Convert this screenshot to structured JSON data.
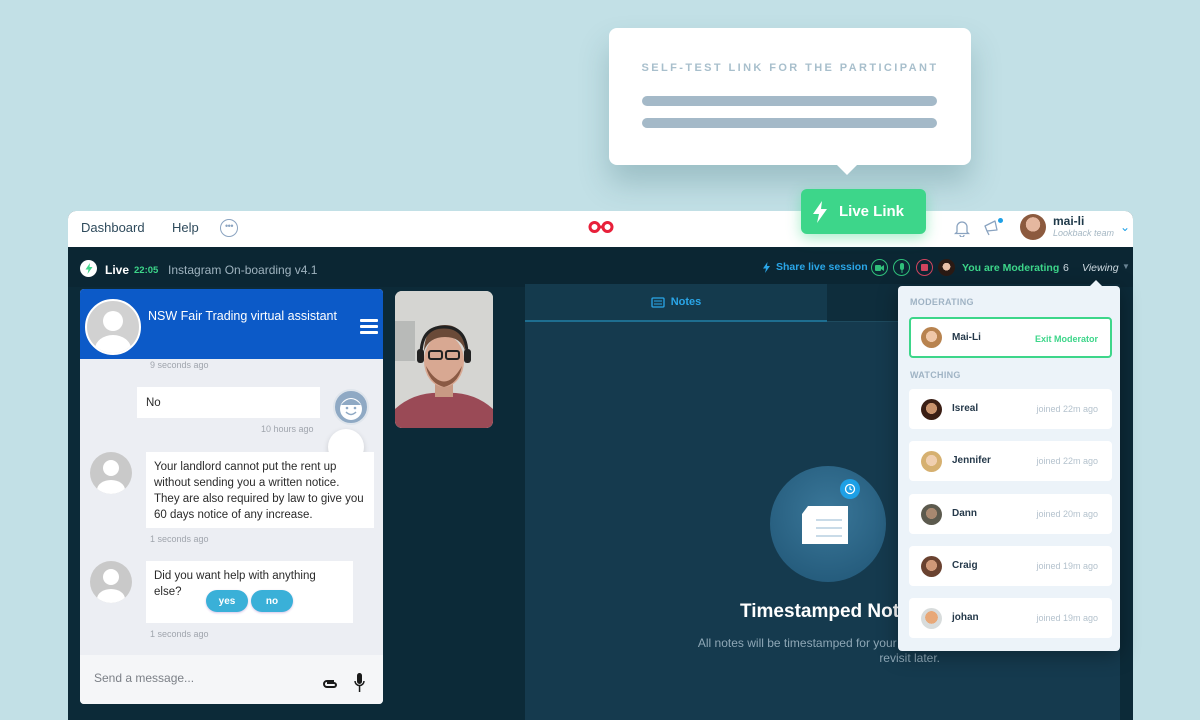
{
  "tooltip": {
    "title": "SELF-TEST LINK FOR THE PARTICIPANT"
  },
  "live_link_button": {
    "label": "Live Link"
  },
  "topbar": {
    "nav": [
      {
        "label": "Dashboard"
      },
      {
        "label": "Help"
      }
    ],
    "more_icon": "ellipsis-icon",
    "logo_icon": "infinity-logo-icon",
    "user": {
      "name": "mai-li",
      "team": "Lookback team"
    }
  },
  "session": {
    "live_label": "Live",
    "elapsed": "22:05",
    "title": "Instagram On-boarding v4.1",
    "share_label": "Share live session",
    "moderating_label": "You are Moderating",
    "viewer_count": "6",
    "viewing_label": "Viewing"
  },
  "chat": {
    "title": "NSW Fair Trading virtual assistant",
    "messages": [
      {
        "time": "9 seconds ago"
      },
      {
        "from": "user",
        "text": "No",
        "time": "10 hours ago"
      },
      {
        "from": "bot",
        "text": "Your landlord cannot put the rent up without sending you a written notice. They are also required by law to give you 60 days notice of any increase.",
        "time": "1 seconds ago"
      },
      {
        "from": "bot",
        "text": "Did you want help with anything else?",
        "time": "1 seconds ago",
        "quick_replies": [
          "yes",
          "no"
        ]
      }
    ],
    "input_placeholder": "Send a message..."
  },
  "notes": {
    "tab_label": "Notes",
    "empty_title": "Timestamped Notes",
    "empty_desc": "All notes will be timestamped for your team to revisit later."
  },
  "viewing_panel": {
    "moderating_header": "MODERATING",
    "moderator": {
      "name": "Mai-Li",
      "action": "Exit Moderator"
    },
    "watching_header": "WATCHING",
    "watchers": [
      {
        "name": "Isreal",
        "joined": "joined 22m ago"
      },
      {
        "name": "Jennifer",
        "joined": "joined 22m ago"
      },
      {
        "name": "Dann",
        "joined": "joined 20m ago"
      },
      {
        "name": "Craig",
        "joined": "joined 19m ago"
      },
      {
        "name": "johan",
        "joined": "joined 19m ago"
      }
    ]
  },
  "colors": {
    "accent_green": "#3dd68a",
    "accent_blue": "#2aa6e8",
    "chat_header_blue": "#0c5ac8",
    "background": "#c2e0e6",
    "app_dark": "#0c2a38",
    "logo_red": "#e8203a"
  }
}
